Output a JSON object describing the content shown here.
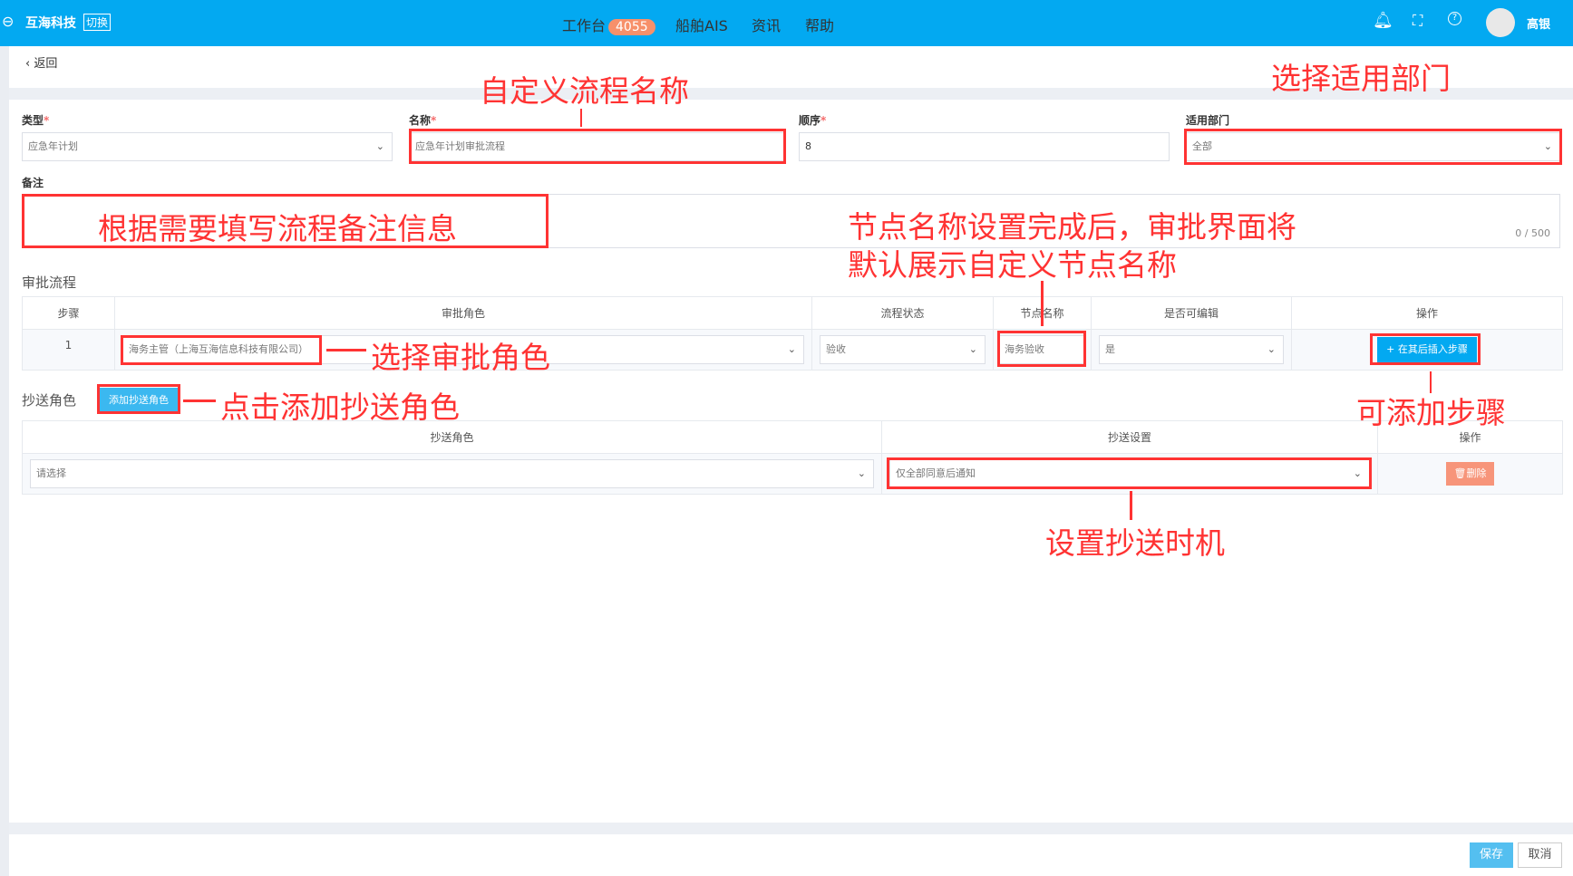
{
  "header": {
    "brand": "互海科技",
    "switch": "切换",
    "nav": [
      {
        "label": "工作台",
        "badge": "4055"
      },
      {
        "label": "船舶AIS"
      },
      {
        "label": "资讯"
      },
      {
        "label": "帮助"
      }
    ],
    "user": "高银",
    "accent": "#03a9f1"
  },
  "back": "返回",
  "form": {
    "type": {
      "label": "类型",
      "value": "应急年计划"
    },
    "name": {
      "label": "名称",
      "value": "应急年计划审批流程"
    },
    "order": {
      "label": "顺序",
      "value": "8"
    },
    "dept": {
      "label": "适用部门",
      "value": "全部"
    },
    "remark": {
      "label": "备注",
      "counter": "0 / 500"
    }
  },
  "approval": {
    "title": "审批流程",
    "columns": [
      "步骤",
      "审批角色",
      "流程状态",
      "节点名称",
      "是否可编辑",
      "操作"
    ],
    "rows": [
      {
        "step": "1",
        "role": "海务主管（上海互海信息科技有限公司）",
        "status": "验收",
        "node": "海务验收",
        "editable": "是",
        "action": "+ 在其后插入步骤"
      }
    ]
  },
  "copy": {
    "title": "抄送角色",
    "add_button": "添加抄送角色",
    "columns": [
      "抄送角色",
      "抄送设置",
      "操作"
    ],
    "rows": [
      {
        "role": "请选择",
        "setting": "仅全部同意后通知",
        "delete": "删除"
      }
    ]
  },
  "footer": {
    "save": "保存",
    "cancel": "取消"
  },
  "annotations": {
    "name": "自定义流程名称",
    "dept": "选择适用部门",
    "remark": "根据需要填写流程备注信息",
    "node1": "节点名称设置完成后，审批界面将",
    "node2": "默认展示自定义节点名称",
    "role": "选择审批角色",
    "copy": "点击添加抄送角色",
    "step": "可添加步骤",
    "timing": "设置抄送时机"
  }
}
